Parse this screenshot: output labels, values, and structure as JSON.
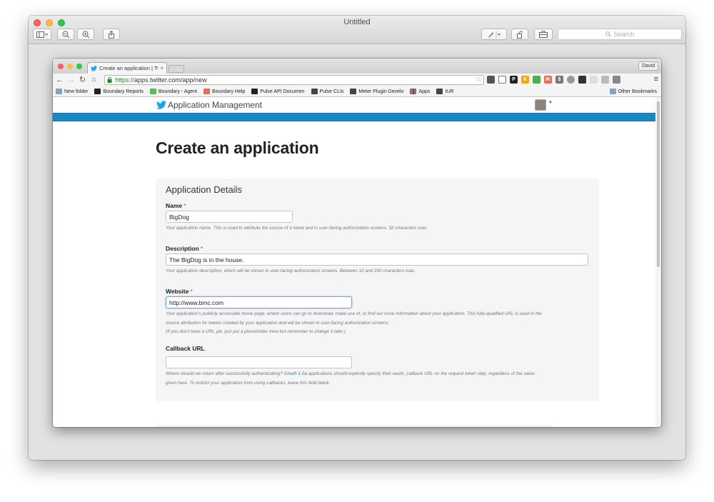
{
  "outer_window": {
    "title": "Untitled",
    "search_placeholder": "Search"
  },
  "browser": {
    "tab_title": "Create an application | Twi",
    "tab_close": "×",
    "profile_name": "David",
    "url_scheme": "https://",
    "url_rest": "apps.twitter.com/app/new",
    "bookmarks": [
      {
        "label": "New folder",
        "icon": "folder-icon"
      },
      {
        "label": "Boundary Reports",
        "icon": "boundary-icon"
      },
      {
        "label": "Boundary - Agent",
        "icon": "boundary-agent-icon"
      },
      {
        "label": "Boundary Help",
        "icon": "help-icon"
      },
      {
        "label": "Pulse API Documen",
        "icon": "boundary-icon"
      },
      {
        "label": "Pulse CLIs",
        "icon": "doc-icon"
      },
      {
        "label": "Meter Plugin Develo",
        "icon": "doc-icon"
      },
      {
        "label": "Apps",
        "icon": "apps-grid-icon"
      },
      {
        "label": "IUR",
        "icon": "doc-icon"
      }
    ],
    "other_bookmarks": "Other Bookmarks"
  },
  "app": {
    "brand": "Application Management",
    "page_title": "Create an application",
    "section_title": "Application Details",
    "fields": {
      "name": {
        "label": "Name",
        "required": "*",
        "value": "BigDog",
        "help": "Your application name. This is used to attribute the source of a tweet and in user-facing authorization screens. 32 characters max."
      },
      "description": {
        "label": "Description",
        "required": "*",
        "value": "The BigDog is in the house.",
        "help": "Your application description, which will be shown in user-facing authorization screens. Between 10 and 200 characters max."
      },
      "website": {
        "label": "Website",
        "required": "*",
        "value": "http://www.bmc.com",
        "help_line1": "Your application's publicly accessible home page, where users can go to download, make use of, or find out more information about your application. This fully-qualified URL is used in the",
        "help_line2": "source attribution for tweets created by your application and will be shown in user-facing authorization screens.",
        "help_line3": "(If you don't have a URL yet, just put a placeholder here but remember to change it later.)"
      },
      "callback": {
        "label": "Callback URL",
        "value": "",
        "help_pre": "Where should we return after successfully authenticating?",
        "help_link": "OAuth 1.0a",
        "help_post": "applications should explicitly specify their oauth_callback URL on the request token step, regardless of the value",
        "help_line2": "given here. To restrict your application from using callbacks, leave this field blank."
      }
    }
  },
  "colors": {
    "twitter_blue": "#1a87c6",
    "required_red": "#e0333c",
    "link_blue": "#2b7bb9"
  }
}
